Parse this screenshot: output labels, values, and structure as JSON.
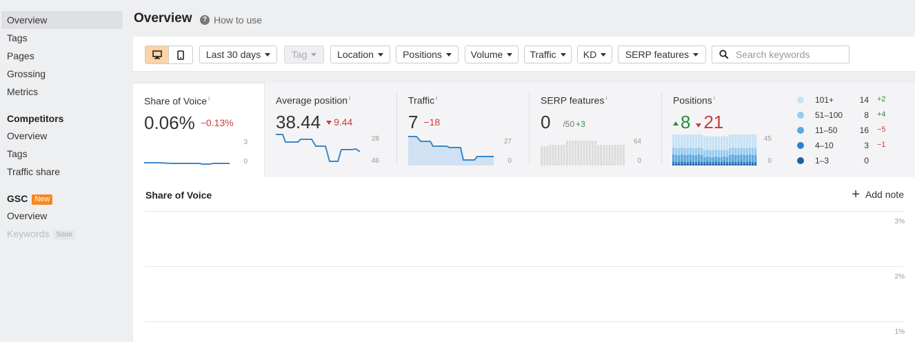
{
  "sidebar": {
    "items": [
      {
        "label": "Overview"
      },
      {
        "label": "Tags"
      },
      {
        "label": "Pages"
      },
      {
        "label": "Grossing"
      },
      {
        "label": "Metrics"
      }
    ],
    "competitors": {
      "heading": "Competitors",
      "items": [
        {
          "label": "Overview"
        },
        {
          "label": "Tags"
        },
        {
          "label": "Traffic share"
        }
      ]
    },
    "gsc": {
      "heading": "GSC",
      "badge": "New",
      "items": [
        {
          "label": "Overview"
        },
        {
          "label": "Keywords",
          "badge": "Soon"
        }
      ]
    }
  },
  "header": {
    "title": "Overview",
    "help_label": "How to use"
  },
  "filters": {
    "desktop_icon": "desktop-icon",
    "mobile_icon": "mobile-icon",
    "date_range": "Last 30 days",
    "tag": "Tag",
    "location": "Location",
    "positions": "Positions",
    "volume": "Volume",
    "traffic": "Traffic",
    "kd": "KD",
    "serp_features": "SERP features",
    "search_placeholder": "Search keywords",
    "search_value": ""
  },
  "metrics": {
    "share_of_voice": {
      "label": "Share of Voice",
      "info": "i",
      "value": "0.06%",
      "delta": "−0.13%",
      "axis_top": "3",
      "axis_bottom": "0"
    },
    "average_position": {
      "label": "Average position",
      "info": "i",
      "value": "38.44",
      "delta": "9.44",
      "axis_top": "28",
      "axis_bottom": "46"
    },
    "traffic": {
      "label": "Traffic",
      "info": "i",
      "value": "7",
      "delta": "−18",
      "axis_top": "27",
      "axis_bottom": "0"
    },
    "serp_features": {
      "label": "SERP features",
      "info": "i",
      "value": "0",
      "sub": "/50",
      "delta": "+3",
      "axis_top": "64",
      "axis_bottom": "0"
    },
    "positions": {
      "label": "Positions",
      "info": "i",
      "up": "8",
      "down": "21",
      "axis_top": "45",
      "axis_bottom": "0"
    }
  },
  "positions_legend": [
    {
      "label": "101+",
      "count": "14",
      "change": "+2",
      "direction": "up",
      "color": "#c6e2f6"
    },
    {
      "label": "51–100",
      "count": "8",
      "change": "+4",
      "direction": "up",
      "color": "#99cbee"
    },
    {
      "label": "11–50",
      "count": "16",
      "change": "−5",
      "direction": "down",
      "color": "#5aa8e0"
    },
    {
      "label": "4–10",
      "count": "3",
      "change": "−1",
      "direction": "down",
      "color": "#2f80c8"
    },
    {
      "label": "1–3",
      "count": "0",
      "change": "",
      "direction": "none",
      "color": "#1f5f9e"
    }
  ],
  "sov_chart": {
    "title": "Share of Voice",
    "add_note": "Add note",
    "ticks": [
      "3%",
      "2%",
      "1%"
    ]
  },
  "colors": {
    "accent": "#fbd3a6",
    "line_blue": "#3b86c6",
    "fill_blue": "#cfe1f2",
    "negative": "#cf3a3a",
    "positive": "#2d8a3a"
  }
}
